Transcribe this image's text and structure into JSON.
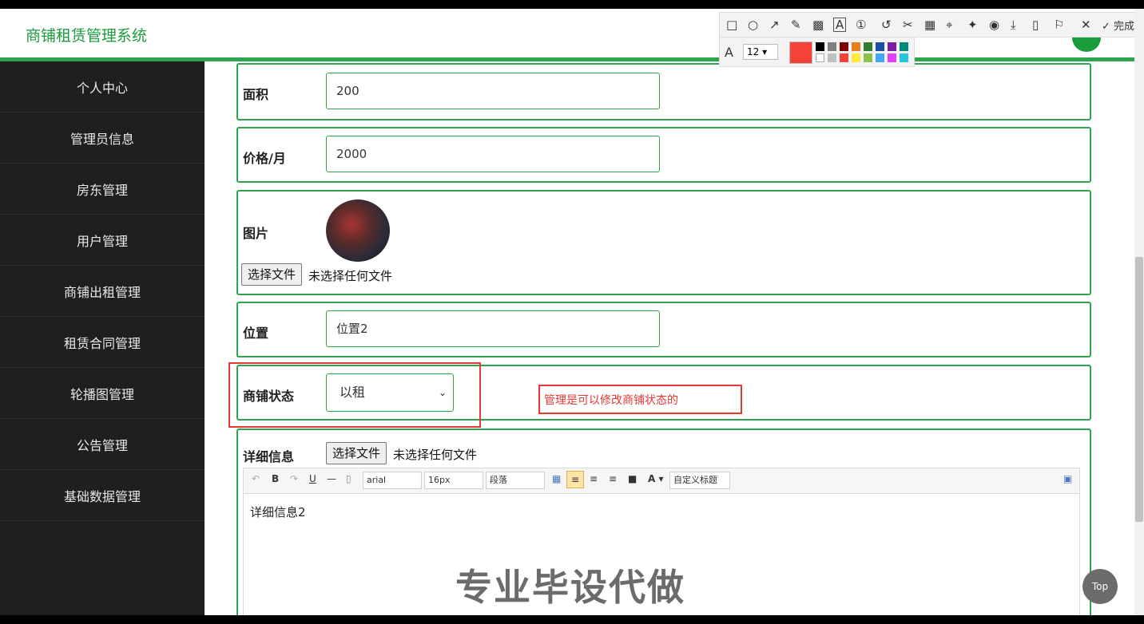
{
  "app": {
    "title": "商铺租赁管理系统"
  },
  "sidebar": {
    "items": [
      {
        "label": "个人中心"
      },
      {
        "label": "管理员信息"
      },
      {
        "label": "房东管理"
      },
      {
        "label": "用户管理"
      },
      {
        "label": "商铺出租管理"
      },
      {
        "label": "租赁合同管理"
      },
      {
        "label": "轮播图管理"
      },
      {
        "label": "公告管理"
      },
      {
        "label": "基础数据管理"
      }
    ]
  },
  "form": {
    "area": {
      "label": "面积",
      "value": "200"
    },
    "price": {
      "label": "价格/月",
      "value": "2000"
    },
    "image": {
      "label": "图片",
      "button": "选择文件",
      "status": "未选择任何文件"
    },
    "location": {
      "label": "位置",
      "value": "位置2"
    },
    "shop_status": {
      "label": "商铺状态",
      "selected": "以租"
    },
    "detail": {
      "label": "详细信息",
      "button": "选择文件",
      "status": "未选择任何文件"
    }
  },
  "editor": {
    "font": "arial",
    "size": "16px",
    "paragraph": "段落",
    "custom_title": "自定义标题",
    "content": "详细信息2"
  },
  "annotation": {
    "text": "管理是可以修改商铺状态的",
    "color": "#e53935"
  },
  "snip_toolbar": {
    "font_size": "12",
    "done_label": "完成",
    "current_color": "#f44336"
  },
  "watermark": "专业毕设代做",
  "top_button": "Top",
  "colors": {
    "accent": "#2ea44f",
    "sidebar_bg": "#1f1f1f",
    "annotation": "#e53935"
  }
}
